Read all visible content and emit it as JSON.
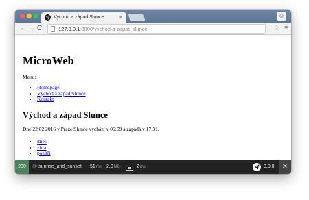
{
  "tab": {
    "title": "Východ a západ Slunce",
    "favicon": "symfony-icon",
    "close": "×"
  },
  "toolbar": {
    "url_host": "127.0.0.1",
    "url_path": ":8000/vychod-a-zapad-slunce",
    "back": "←",
    "forward": "→",
    "reload": "C",
    "star": "☆",
    "menu": "≡"
  },
  "page": {
    "site_title": "MicroWeb",
    "menu_label": "Menu:",
    "menu_items": [
      "Homepage",
      "Východ a západ Slunce",
      "Kontakt"
    ],
    "section_title": "Východ a západ Slunce",
    "paragraph": "Dne 22.02.2016 v Praze Slunce vychází v 06:59 a zapadá v 17:31.",
    "days": [
      "dnes",
      "zítra",
      "pozítří"
    ]
  },
  "sfbar": {
    "status": "200",
    "route_at": "@",
    "route": "sunrise_and_sunset",
    "time_value": "51",
    "time_unit": "ms",
    "memory_value": "2.0",
    "memory_unit": "MB",
    "db_value": "2",
    "db_unit": "ms",
    "logo": "sf",
    "version": "3.0.0",
    "close": "✕"
  },
  "colors": {
    "status_ok": "#4f805d",
    "link": "#0000ee",
    "toolbar_bg": "#222222"
  }
}
